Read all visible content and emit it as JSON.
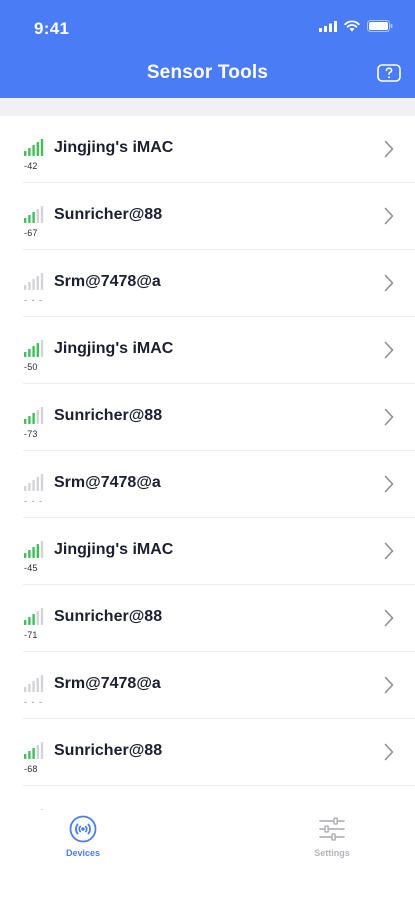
{
  "status_bar": {
    "time": "9:41"
  },
  "header": {
    "title": "Sensor Tools",
    "help_icon": "help-icon"
  },
  "colors": {
    "accent": "#4a7cf6",
    "signal_active": "#3fbf5a",
    "signal_inactive": "#d3d3d8"
  },
  "devices": [
    {
      "name": "Jingjing's iMAC",
      "rssi": "-42",
      "bars": 4
    },
    {
      "name": "Sunricher@88",
      "rssi": "-67",
      "bars": 2
    },
    {
      "name": "Srm@7478@a",
      "rssi": "- - -",
      "bars": 0
    },
    {
      "name": "Jingjing's iMAC",
      "rssi": "-50",
      "bars": 3
    },
    {
      "name": "Sunricher@88",
      "rssi": "-73",
      "bars": 2
    },
    {
      "name": "Srm@7478@a",
      "rssi": "- - -",
      "bars": 0
    },
    {
      "name": "Jingjing's iMAC",
      "rssi": "-45",
      "bars": 3
    },
    {
      "name": "Sunricher@88",
      "rssi": "-71",
      "bars": 2
    },
    {
      "name": "Srm@7478@a",
      "rssi": "- - -",
      "bars": 0
    },
    {
      "name": "Sunricher@88",
      "rssi": "-68",
      "bars": 2
    },
    {
      "name": "",
      "rssi": "",
      "bars": 0
    }
  ],
  "tabbar": {
    "devices": {
      "label": "Devices",
      "icon": "broadcast-icon",
      "active": true
    },
    "settings": {
      "label": "Settings",
      "icon": "sliders-icon",
      "active": false
    }
  }
}
